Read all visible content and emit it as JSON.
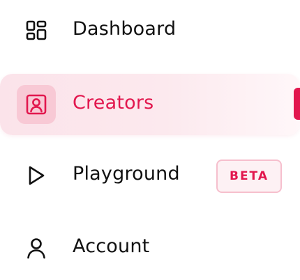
{
  "nav": {
    "items": [
      {
        "label": "Dashboard",
        "icon": "dashboard-grid-icon",
        "active": false
      },
      {
        "label": "Creators",
        "icon": "creator-portrait-icon",
        "active": true
      },
      {
        "label": "Playground",
        "icon": "play-icon",
        "active": false,
        "badge": "BETA"
      },
      {
        "label": "Account",
        "icon": "user-icon",
        "active": false
      }
    ]
  },
  "colors": {
    "accent": "#e2174e",
    "active_background": "#fbe3ea",
    "active_icon_background": "#f8c9d5",
    "badge_border": "#f6bfcd",
    "text": "#111111"
  }
}
